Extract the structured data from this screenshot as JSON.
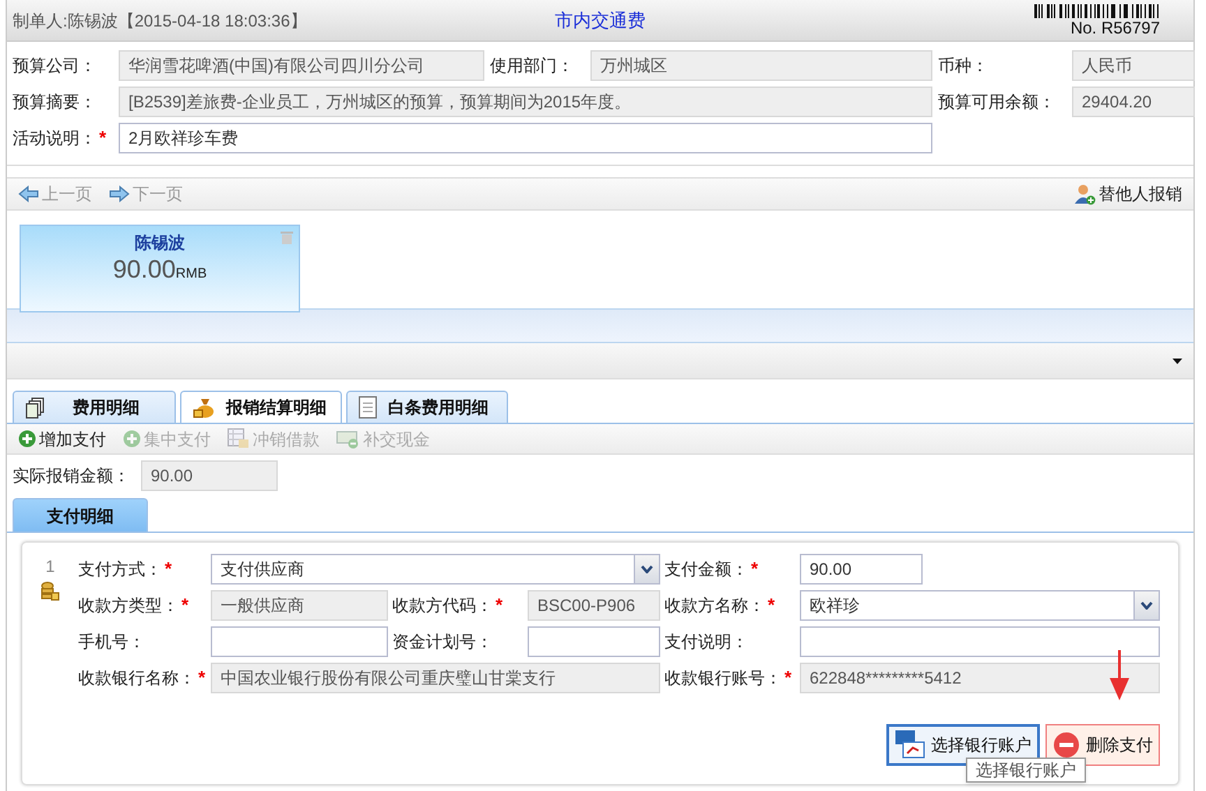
{
  "header": {
    "creator": "制单人:陈锡波【2015-04-18 18:03:36】",
    "title": "市内交通费",
    "number": "No. R56797"
  },
  "budget_rows": [
    {
      "fields": [
        {
          "label": "预算公司：",
          "value": "华润雪花啤酒(中国)有限公司四川分公司",
          "kind": "readonly"
        },
        {
          "label": "使用部门：",
          "value": "万州城区",
          "kind": "readonly"
        },
        {
          "label": "币种：",
          "value": "人民币",
          "kind": "readonly"
        }
      ]
    },
    {
      "fields": [
        {
          "label": "预算摘要：",
          "value": "[B2539]差旅费-企业员工，万州城区的预算，预算期间为2015年度。",
          "kind": "readonly"
        },
        {
          "label": "预算可用余额：",
          "value": "29404.20",
          "kind": "readonly"
        }
      ]
    },
    {
      "fields": [
        {
          "label": "活动说明：",
          "required_mark": "*",
          "value": "2月欧祥珍车费",
          "kind": "input"
        }
      ]
    }
  ],
  "nav": {
    "prev": {
      "label": "上一页",
      "disabled": true
    },
    "next": {
      "label": "下一页",
      "disabled": true
    },
    "other": "替他人报销"
  },
  "person_card": {
    "name": "陈锡波",
    "amount": "90.00",
    "currency": "RMB"
  },
  "tabs": [
    {
      "label": "费用明细",
      "selected": false
    },
    {
      "label": "报销结算明细",
      "selected": true
    },
    {
      "label": "白条费用明细",
      "selected": false
    }
  ],
  "toolbar": [
    {
      "label": "增加支付",
      "disabled": false
    },
    {
      "label": "集中支付",
      "disabled": true
    },
    {
      "label": "冲销借款",
      "disabled": true
    },
    {
      "label": "补交现金",
      "disabled": true
    }
  ],
  "actual_amount": {
    "label": "实际报销金额：",
    "value": "90.00"
  },
  "sub_tabs": [
    {
      "label": "支付明细",
      "selected": true
    }
  ],
  "payment": {
    "index": "1",
    "rows": [
      {
        "fields": [
          {
            "label": "支付方式：",
            "required_mark": "*",
            "value": "支付供应商",
            "kind": "select"
          },
          {
            "label": "支付金额：",
            "required_mark": "*",
            "value": "90.00",
            "kind": "input"
          }
        ]
      },
      {
        "fields": [
          {
            "label": "收款方类型：",
            "required_mark": "*",
            "value": "一般供应商",
            "kind": "readonly"
          },
          {
            "label": "收款方代码：",
            "required_mark": "*",
            "value": "BSC00-P906",
            "kind": "readonly"
          },
          {
            "label": "收款方名称：",
            "required_mark": "*",
            "value": "欧祥珍",
            "kind": "select"
          }
        ]
      },
      {
        "fields": [
          {
            "label": "手机号：",
            "kind": "input"
          },
          {
            "label": "资金计划号：",
            "kind": "input"
          },
          {
            "label": "支付说明：",
            "kind": "input"
          }
        ]
      },
      {
        "fields": [
          {
            "label": "收款银行名称：",
            "required_mark": "*",
            "value": "中国农业银行股份有限公司重庆璧山甘棠支行",
            "kind": "readonly"
          },
          {
            "label": "收款银行账号：",
            "required_mark": "*",
            "value": "622848*********5412",
            "kind": "readonly"
          }
        ]
      }
    ],
    "buttons": [
      {
        "label": "选择银行账户",
        "kind": "bank"
      },
      {
        "label": "删除支付",
        "kind": "delete"
      }
    ],
    "tooltip": "选择银行账户"
  }
}
